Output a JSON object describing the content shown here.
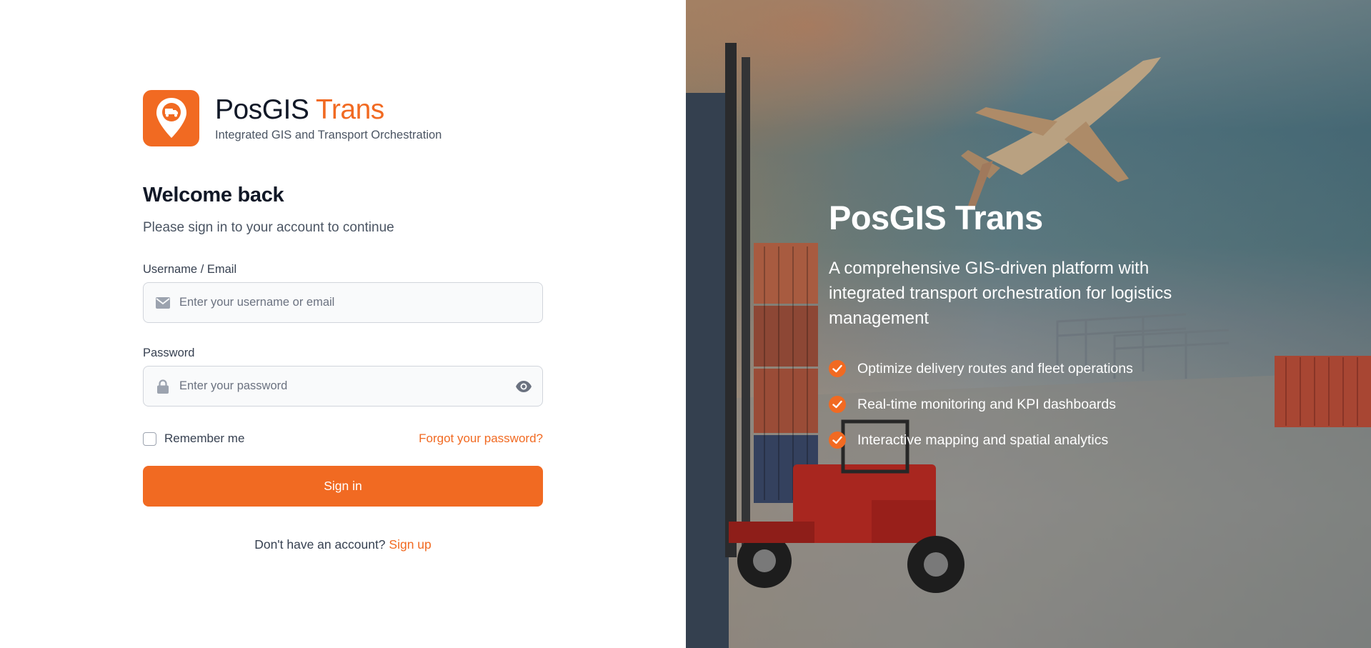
{
  "brand": {
    "name_primary": "PosGIS",
    "name_accent": "Trans",
    "tagline": "Integrated GIS and Transport Orchestration",
    "accent_color": "#f16a22"
  },
  "login": {
    "title": "Welcome back",
    "subtitle": "Please sign in to your account to continue",
    "username": {
      "label": "Username / Email",
      "placeholder": "Enter your username or email",
      "value": ""
    },
    "password": {
      "label": "Password",
      "placeholder": "Enter your password",
      "value": ""
    },
    "remember_label": "Remember me",
    "remember_checked": false,
    "forgot_label": "Forgot your password?",
    "submit_label": "Sign in",
    "signup_prompt": "Don't have an account?",
    "signup_label": "Sign up"
  },
  "hero": {
    "title": "PosGIS Trans",
    "description": "A comprehensive GIS-driven platform with integrated transport orchestration for logistics management",
    "features": [
      {
        "label": "Optimize delivery routes and fleet operations"
      },
      {
        "label": "Real-time monitoring and KPI dashboards"
      },
      {
        "label": "Interactive mapping and spatial analytics"
      }
    ]
  },
  "icons": {
    "logo": "map-pin-truck-icon",
    "username": "envelope-icon",
    "password": "lock-icon",
    "password_toggle": "eye-icon",
    "feature": "check-circle-icon"
  }
}
